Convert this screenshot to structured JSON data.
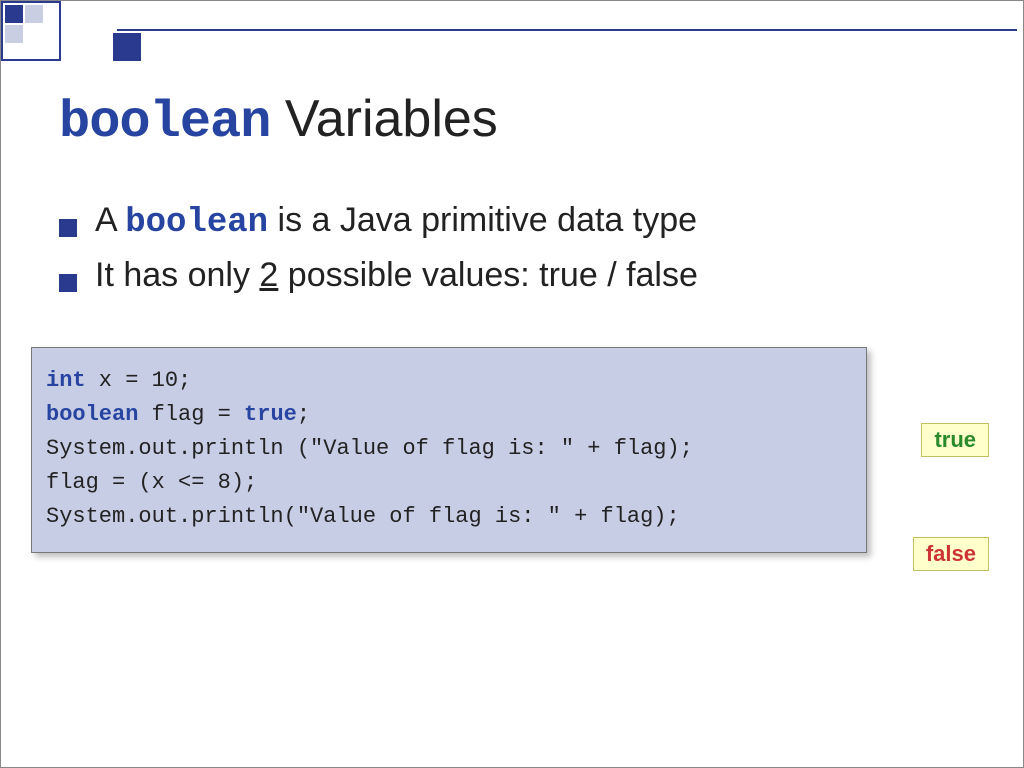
{
  "title": {
    "keyword": "boolean",
    "rest": " Variables"
  },
  "bullets": [
    {
      "pre": "A ",
      "keyword": "boolean",
      "post": "  is a Java primitive data type"
    },
    {
      "pre": "It has only ",
      "underlined": "2",
      "post": " possible values: true / false"
    }
  ],
  "code": {
    "l1a": "int",
    "l1b": " x = 10;",
    "l2a": "boolean",
    "l2b": " flag = ",
    "l2c": "true",
    "l2d": ";",
    "l3": "System.out.println (\"Value of flag is: \" + flag);",
    "l4": " ",
    "l5": "flag = (x <= 8);",
    "l6": "System.out.println(\"Value of flag is: \" + flag);"
  },
  "badges": {
    "true": "true",
    "false": "false"
  }
}
